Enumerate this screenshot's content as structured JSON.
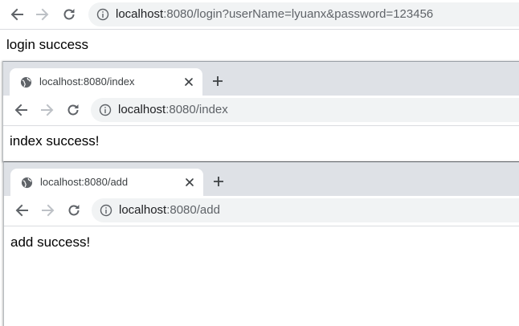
{
  "windows": [
    {
      "id": "login",
      "url_host": "localhost",
      "url_rest": ":8080/login?userName=lyuanx&password=123456",
      "page_text": "login success"
    },
    {
      "id": "index",
      "tab_title": "localhost:8080/index",
      "url_host": "localhost",
      "url_rest": ":8080/index",
      "page_text": "index success!"
    },
    {
      "id": "add",
      "tab_title": "localhost:8080/add",
      "url_host": "localhost",
      "url_rest": ":8080/add",
      "page_text": "add success!"
    }
  ],
  "icons": {
    "back": "arrow-left-icon",
    "forward": "arrow-right-icon",
    "reload": "reload-icon",
    "info": "info-icon",
    "favicon": "globe-icon",
    "close": "close-icon",
    "new_tab": "plus-icon"
  },
  "colors": {
    "tabstrip": "#dee1e6",
    "omnibox": "#f1f3f4",
    "icon_active": "#5f6368",
    "icon_disabled": "#bdc1c6"
  }
}
